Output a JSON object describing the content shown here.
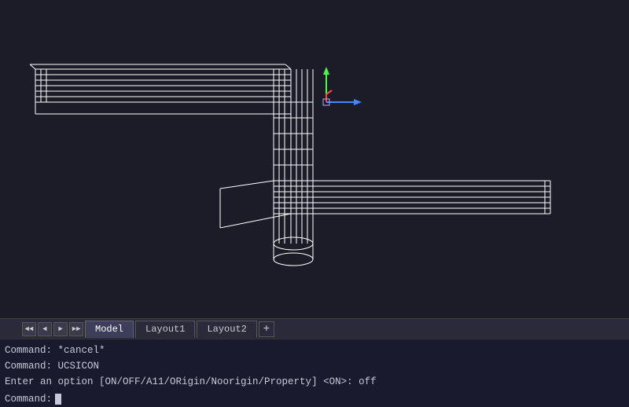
{
  "viewport": {
    "background": "#1c1c28"
  },
  "tabs": [
    {
      "label": "Model",
      "active": true
    },
    {
      "label": "Layout1",
      "active": false
    },
    {
      "label": "Layout2",
      "active": false
    }
  ],
  "tab_add_label": "+",
  "command_lines": [
    {
      "text": "Command: *cancel*"
    },
    {
      "text": "Command: UCSICON"
    },
    {
      "text": "Enter an option [ON/OFF/A11/ORigin/Noorigin/Property] <ON>: off"
    }
  ],
  "command_prompt": "Command:",
  "nav_buttons": [
    "◄◄",
    "◄",
    "►",
    "►►"
  ],
  "ucs": {
    "x_color": "#ff4444",
    "y_color": "#44ff44",
    "z_color": "#4444ff"
  }
}
